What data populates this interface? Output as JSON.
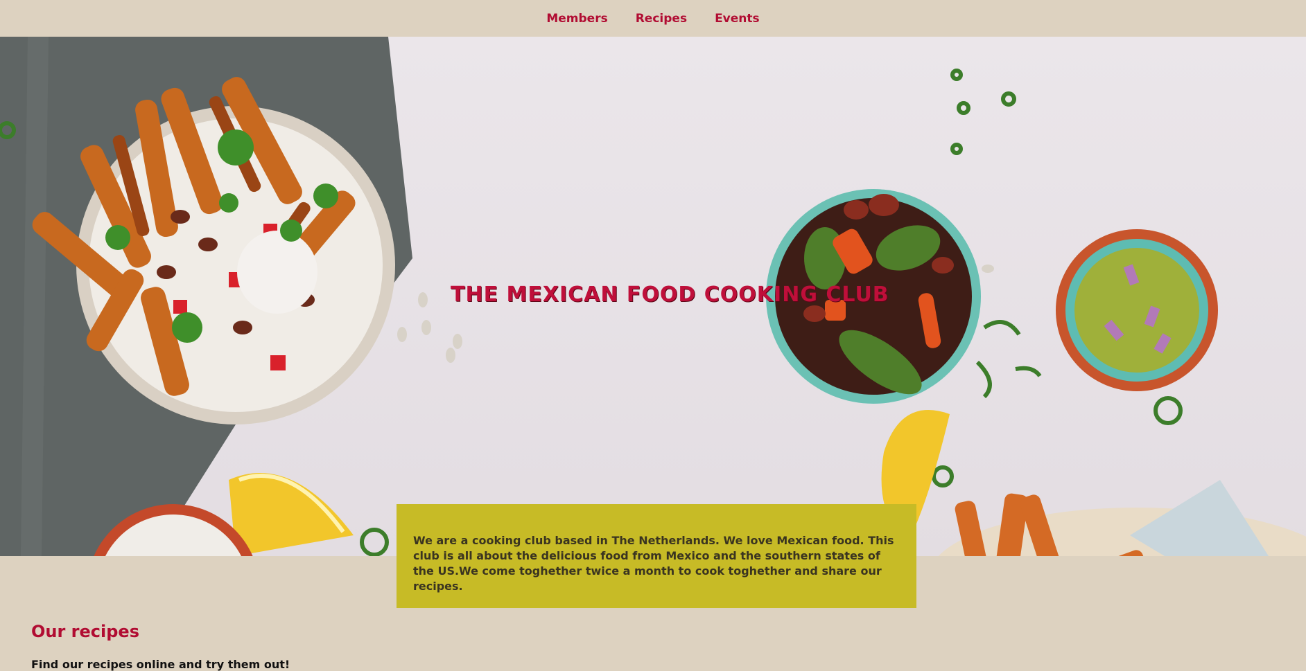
{
  "nav": {
    "items": [
      {
        "label": "Members"
      },
      {
        "label": "Recipes"
      },
      {
        "label": "Events"
      }
    ]
  },
  "hero": {
    "title": "THE MEXICAN FOOD COOKING CLUB"
  },
  "intro": {
    "text": "We are a cooking club based in The Netherlands. We love Mexican food. This club is all about the delicious food from Mexico and the southern states of the US.We come toghether twice a month to cook toghether and share our recipes."
  },
  "recipes": {
    "heading": "Our recipes",
    "subtitle": "Find our recipes online and try them out!"
  },
  "colors": {
    "accent": "#b10c32",
    "page_bg": "#ddd2c0",
    "intro_bg": "#c7bb26"
  }
}
